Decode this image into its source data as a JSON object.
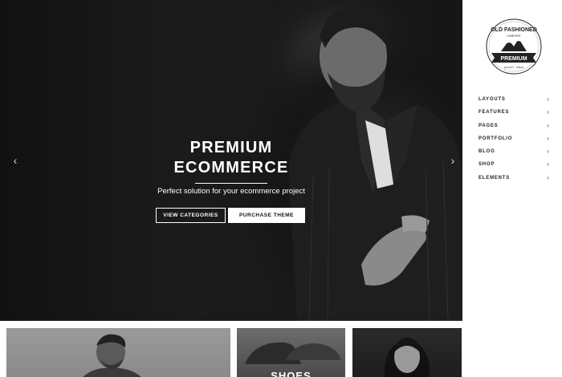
{
  "hero": {
    "title_line1": "PREMIUM",
    "title_line2": "ECOMMERCE",
    "subtitle": "Perfect solution for your ecommerce project",
    "btn_categories": "VIEW CATEGORIES",
    "btn_purchase": "PURCHASE THEME",
    "prev_arrow": "‹",
    "next_arrow": "›"
  },
  "logo": {
    "top_text": "OLD FASHIONED",
    "mid_text": "COMFORT",
    "banner_text": "PREMIUM",
    "bottom_text": "QUALITY · SINCE"
  },
  "nav": {
    "items": [
      {
        "label": "LAYOUTS"
      },
      {
        "label": "FEATURES"
      },
      {
        "label": "PAGES"
      },
      {
        "label": "PORTFOLIO"
      },
      {
        "label": "BLOG"
      },
      {
        "label": "SHOP"
      },
      {
        "label": "ELEMENTS"
      }
    ],
    "chevron": "›"
  },
  "tiles": [
    {
      "label": ""
    },
    {
      "label": "SHOES"
    },
    {
      "label": ""
    }
  ],
  "colors": {
    "hero_bg": "#161616",
    "accent": "#ffffff",
    "nav_text": "#222222"
  }
}
